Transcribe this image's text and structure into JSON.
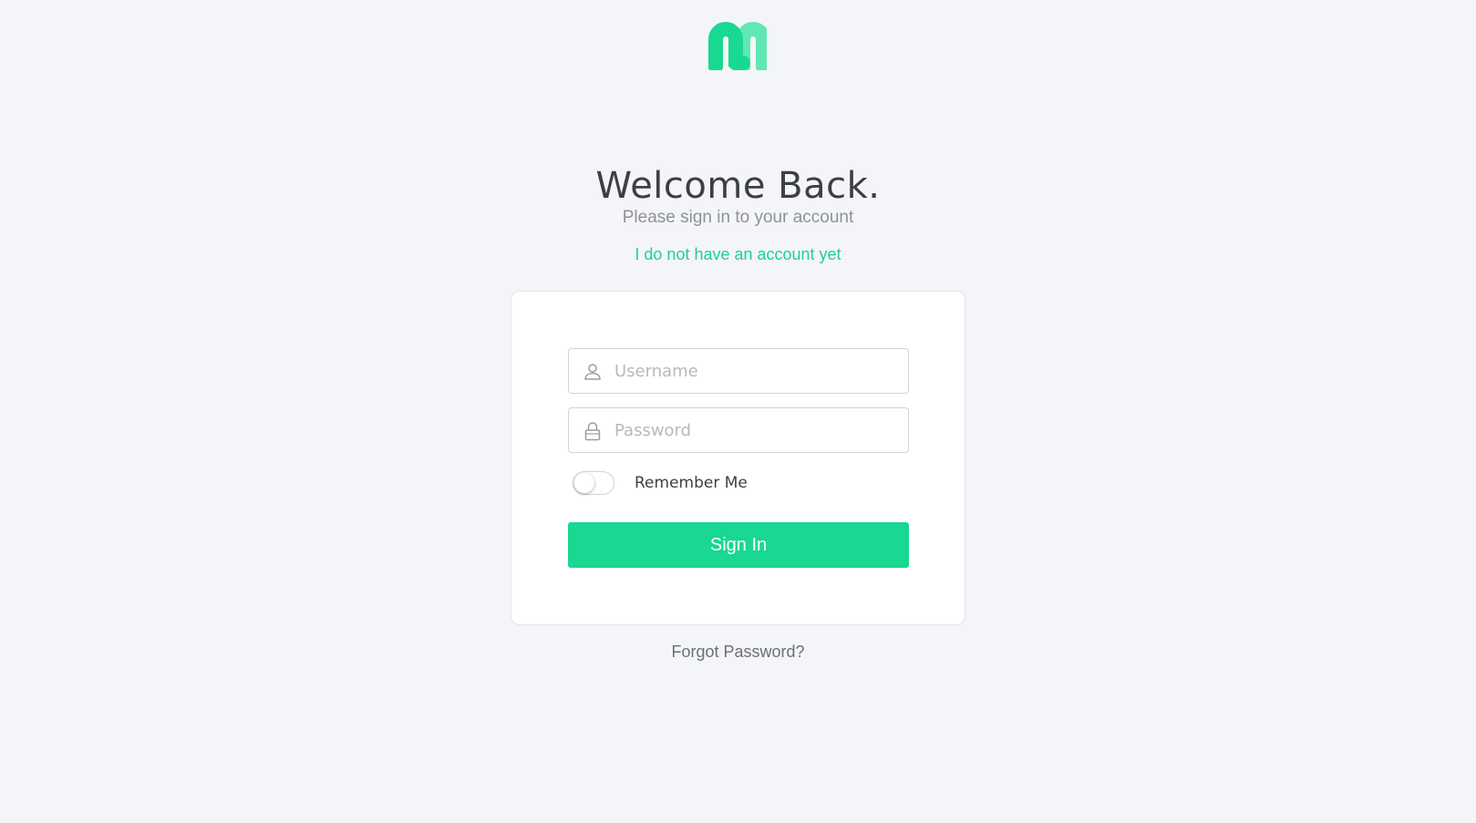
{
  "brand": {
    "logo_icon": "m-logo-icon",
    "primary_color": "#18d892",
    "logo_light_color": "#5fe8b4"
  },
  "header": {
    "title": "Welcome Back.",
    "subtitle": "Please sign in to your account",
    "register_link": "I do not have an account yet"
  },
  "form": {
    "username": {
      "placeholder": "Username",
      "value": "",
      "icon": "user-icon"
    },
    "password": {
      "placeholder": "Password",
      "value": "",
      "icon": "lock-icon"
    },
    "remember_me": {
      "label": "Remember Me",
      "checked": false
    },
    "submit_label": "Sign In"
  },
  "footer": {
    "forgot_password": "Forgot Password?"
  }
}
